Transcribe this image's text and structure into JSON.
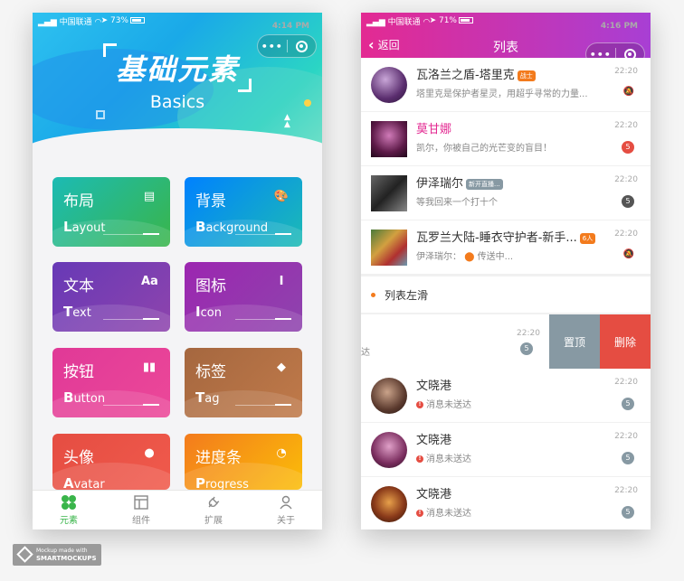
{
  "left": {
    "status": {
      "carrier": "中国联通",
      "time": "4:14 PM",
      "battery": "73%"
    },
    "hero": {
      "title_cn": "基础元素",
      "title_en": "Basics"
    },
    "cards": [
      {
        "cn": "布局",
        "en_first": "L",
        "en_rest": "ayout",
        "icon": "newspaper-icon",
        "glyph": "▤",
        "bg": "linear-gradient(135deg,#1cbbb4,#39b54a)"
      },
      {
        "cn": "背景",
        "en_first": "B",
        "en_rest": "ackground",
        "icon": "palette-icon",
        "glyph": "🎨",
        "bg": "linear-gradient(135deg,#0081ff,#1cbbb4)"
      },
      {
        "cn": "文本",
        "en_first": "T",
        "en_rest": "ext",
        "icon": "text-font-icon",
        "glyph": "Aa",
        "bg": "linear-gradient(135deg,#6739b6,#8e44ad)"
      },
      {
        "cn": "图标",
        "en_first": "I",
        "en_rest": "con",
        "icon": "i-cursor-icon",
        "glyph": "I",
        "bg": "linear-gradient(135deg,#9c26b0,#8e44ad)"
      },
      {
        "cn": "按钮",
        "en_first": "B",
        "en_rest": "utton",
        "icon": "video-play-icon",
        "glyph": "▮▮",
        "bg": "linear-gradient(135deg,#e03997,#ec4899)"
      },
      {
        "cn": "标签",
        "en_first": "T",
        "en_rest": "ag",
        "icon": "tag-icon",
        "glyph": "◆",
        "bg": "linear-gradient(135deg,#a5673f,#c07a4a)"
      },
      {
        "cn": "头像",
        "en_first": "A",
        "en_rest": "vatar",
        "icon": "user-icon",
        "glyph": "●",
        "bg": "linear-gradient(135deg,#e54d42,#f05a4c)"
      },
      {
        "cn": "进度条",
        "en_first": "P",
        "en_rest": "rogress",
        "icon": "loading-icon",
        "glyph": "◔",
        "bg": "linear-gradient(135deg,#f37b1d,#fbbd08)"
      }
    ],
    "tabs": [
      {
        "label": "元素",
        "icon": "clover-icon",
        "active": true
      },
      {
        "label": "组件",
        "icon": "layout-icon",
        "active": false
      },
      {
        "label": "扩展",
        "icon": "plug-icon",
        "active": false
      },
      {
        "label": "关于",
        "icon": "profile-icon",
        "active": false
      }
    ]
  },
  "right": {
    "status": {
      "carrier": "中国联通",
      "time": "4:16 PM",
      "battery": "71%"
    },
    "nav": {
      "back": "返回",
      "title": "列表"
    },
    "items": [
      {
        "name": "瓦洛兰之盾-塔里克",
        "tag": "战士",
        "tag_color": "#f37b1d",
        "msg": "塔里克是保护者星灵，用超乎寻常的力量...",
        "time": "22:20",
        "badge": "",
        "muted": true,
        "avatar_bg": "radial-gradient(circle at 40% 35%,#c9a6d8,#5a2d6e 60%,#2a1638)",
        "round": true,
        "pink": false
      },
      {
        "name": "莫甘娜",
        "tag": "",
        "tag_color": "",
        "msg": "凯尔，你被自己的光芒变的盲目！",
        "time": "22:20",
        "badge": "5",
        "badge_color": "#e54d42",
        "muted": false,
        "avatar_bg": "radial-gradient(circle at 50% 40%,#d07ab8,#5d1a48 60%,#20081a)",
        "round": false,
        "pink": true
      },
      {
        "name": "伊泽瑞尔",
        "tag": "新开直播...",
        "tag_color": "#8799a3",
        "msg": "等我回来一个打十个",
        "time": "22:20",
        "badge": "5",
        "badge_color": "#555555",
        "muted": false,
        "avatar_bg": "linear-gradient(135deg,#666,#222 50%,#888)",
        "round": false,
        "pink": false
      },
      {
        "name": "瓦罗兰大陆-睡衣守护者-新手...",
        "tag": "6人",
        "tag_color": "#f37b1d",
        "msg": "伊泽瑞尔：",
        "msg2": "传送中...",
        "time": "22:20",
        "badge": "",
        "muted": true,
        "avatar_bg": "linear-gradient(135deg,#4a7a3a,#d2a040 40%,#b03030 70%,#6a9ab0)",
        "round": false,
        "pink": false
      }
    ],
    "section_title": "列表左滑",
    "swipe": {
      "left_text": "达",
      "time": "22:20",
      "badge": "5",
      "btn_top": "置顶",
      "btn_del": "删除"
    },
    "items2": [
      {
        "name": "文晓港",
        "msg": "消息未送达",
        "time": "22:20",
        "badge": "5",
        "avatar_bg": "radial-gradient(circle at 45% 40%,#caa38a,#5b3a2e 60%,#221410)"
      },
      {
        "name": "文晓港",
        "msg": "消息未送达",
        "time": "22:20",
        "badge": "5",
        "avatar_bg": "radial-gradient(circle at 50% 40%,#e0a0c8,#7a2d5e 60%,#2a0f22)"
      },
      {
        "name": "文晓港",
        "msg": "消息未送达",
        "time": "22:20",
        "badge": "5",
        "avatar_bg": "radial-gradient(circle at 50% 45%,#e7a04a,#8a3a1a 55%,#2a1208)"
      }
    ]
  },
  "watermark": {
    "line1": "Mockup made with",
    "line2": "SMARTMOCKUPS"
  }
}
